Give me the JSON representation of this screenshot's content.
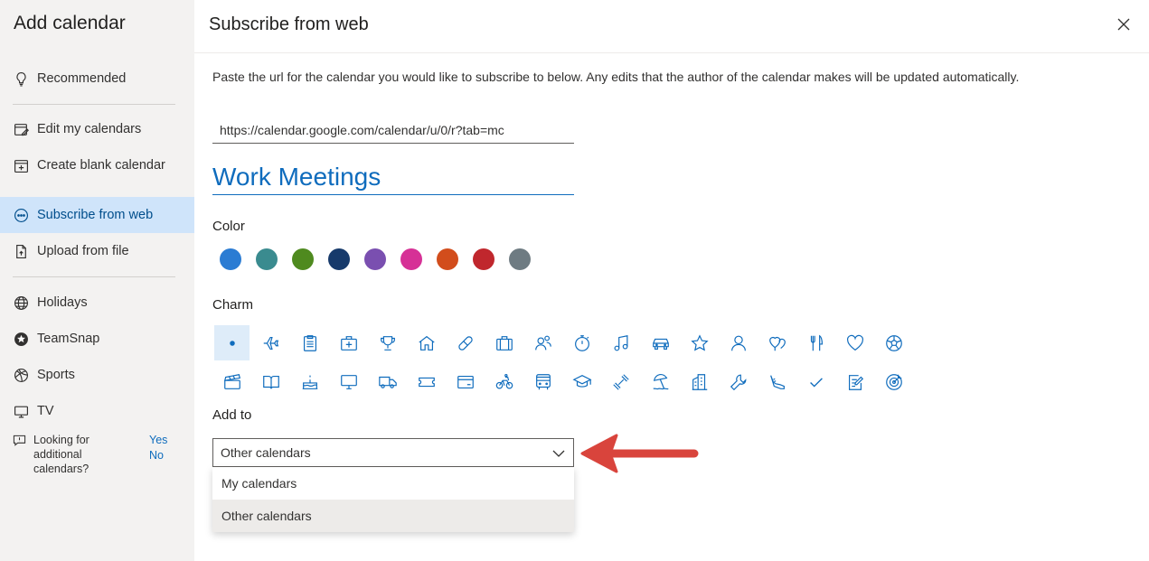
{
  "sidebar": {
    "title": "Add calendar",
    "items": [
      {
        "label": "Recommended",
        "icon": "lightbulb-icon"
      },
      {
        "label": "Edit my calendars",
        "icon": "edit-calendar-icon"
      },
      {
        "label": "Create blank calendar",
        "icon": "add-calendar-icon"
      },
      {
        "label": "Subscribe from web",
        "icon": "link-icon",
        "active": true
      },
      {
        "label": "Upload from file",
        "icon": "file-icon"
      },
      {
        "label": "Holidays",
        "icon": "globe-icon"
      },
      {
        "label": "TeamSnap",
        "icon": "teamsnap-icon"
      },
      {
        "label": "Sports",
        "icon": "sports-ball-icon"
      },
      {
        "label": "TV",
        "icon": "tv-icon"
      }
    ],
    "feedback": {
      "text": "Looking for additional calendars?",
      "yes": "Yes",
      "no": "No"
    }
  },
  "main": {
    "title": "Subscribe from web",
    "description": "Paste the url for the calendar you would like to subscribe to below. Any edits that the author of the calendar makes will be updated automatically.",
    "url_value": "https://calendar.google.com/calendar/u/0/r?tab=mc",
    "name_value": "Work Meetings",
    "color_label": "Color",
    "colors": [
      "#2b7cd3",
      "#3a8b8f",
      "#4f8a1f",
      "#173a6b",
      "#7a4fb0",
      "#d63196",
      "#d24d1c",
      "#c0272d",
      "#6e7b82"
    ],
    "charm_label": "Charm",
    "add_to_label": "Add to",
    "add_to_selected": "Other calendars",
    "add_to_options": [
      "My calendars",
      "Other calendars"
    ]
  },
  "accent_color": "#0f6cbd",
  "arrow_color": "#d9443c"
}
